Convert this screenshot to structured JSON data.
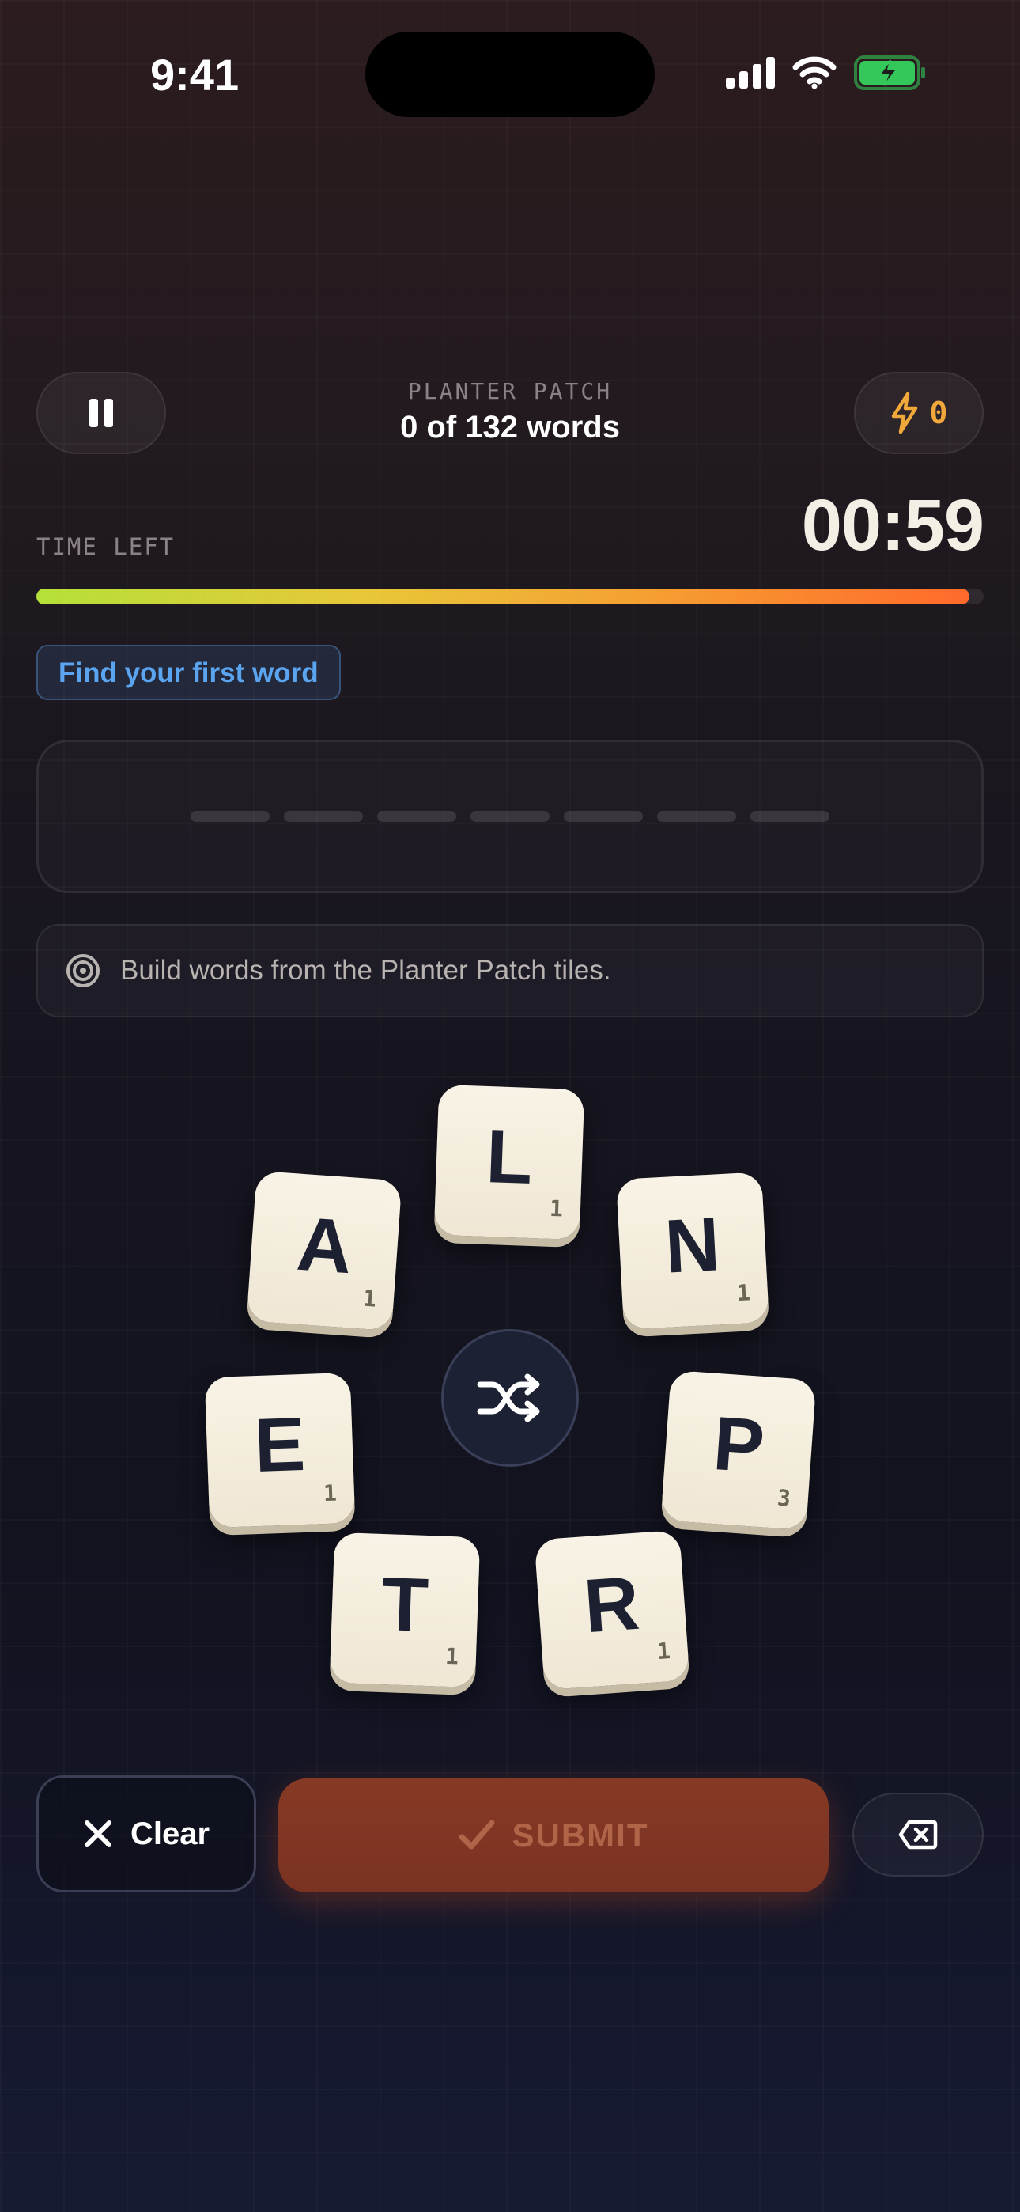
{
  "status_bar": {
    "time": "9:41"
  },
  "header": {
    "puzzle_name": "PLANTER PATCH",
    "progress_text": "0 of 132 words",
    "score": "0"
  },
  "timer": {
    "label": "TIME LEFT",
    "value": "00:59",
    "remaining_fraction": 0.985
  },
  "hint_chip": "Find your first word",
  "word_slots": 7,
  "info": {
    "text": "Build words from the Planter Patch tiles."
  },
  "tiles": [
    {
      "letter": "L",
      "points": "1"
    },
    {
      "letter": "A",
      "points": "1"
    },
    {
      "letter": "N",
      "points": "1"
    },
    {
      "letter": "E",
      "points": "1"
    },
    {
      "letter": "P",
      "points": "3"
    },
    {
      "letter": "T",
      "points": "1"
    },
    {
      "letter": "R",
      "points": "1"
    }
  ],
  "controls": {
    "clear_label": "Clear",
    "submit_label": "SUBMIT"
  },
  "colors": {
    "accent_orange": "#ff6a2b",
    "score_amber": "#f0a83a",
    "hint_blue": "#5aa4f0",
    "battery_green": "#34c759"
  }
}
